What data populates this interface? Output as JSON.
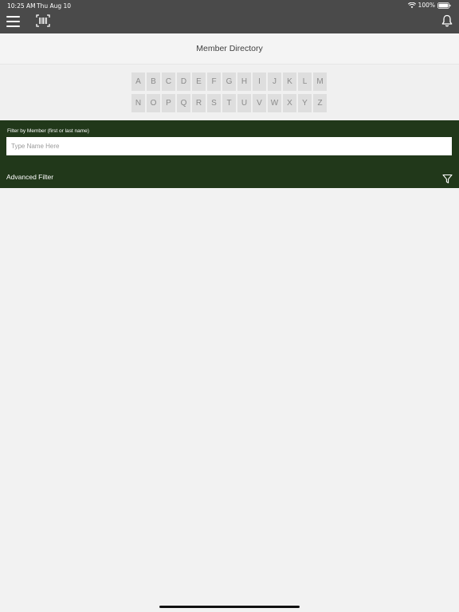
{
  "status_bar": {
    "time": "10:25 AM",
    "date": "Thu Aug 10",
    "battery": "100%",
    "icons": [
      "wifi-icon",
      "battery-icon"
    ]
  },
  "nav": {
    "icons": [
      "menu-icon",
      "barcode-icon",
      "bell-icon"
    ]
  },
  "page": {
    "title": "Member Directory"
  },
  "alphabet": {
    "row1": [
      "A",
      "B",
      "C",
      "D",
      "E",
      "F",
      "G",
      "H",
      "I",
      "J",
      "K",
      "L",
      "M"
    ],
    "row2": [
      "N",
      "O",
      "P",
      "Q",
      "R",
      "S",
      "T",
      "U",
      "V",
      "W",
      "X",
      "Y",
      "Z"
    ]
  },
  "filter": {
    "label": "Filter by Member (first or last name)",
    "value": "",
    "placeholder": "Type Name Here",
    "advanced_label": "Advanced Filter",
    "icon": "filter-icon"
  },
  "colors": {
    "top_bar": "#4a4a4a",
    "filter_panel": "#21381a",
    "background": "#f2f2f2",
    "alpha_key": "#dedede"
  }
}
